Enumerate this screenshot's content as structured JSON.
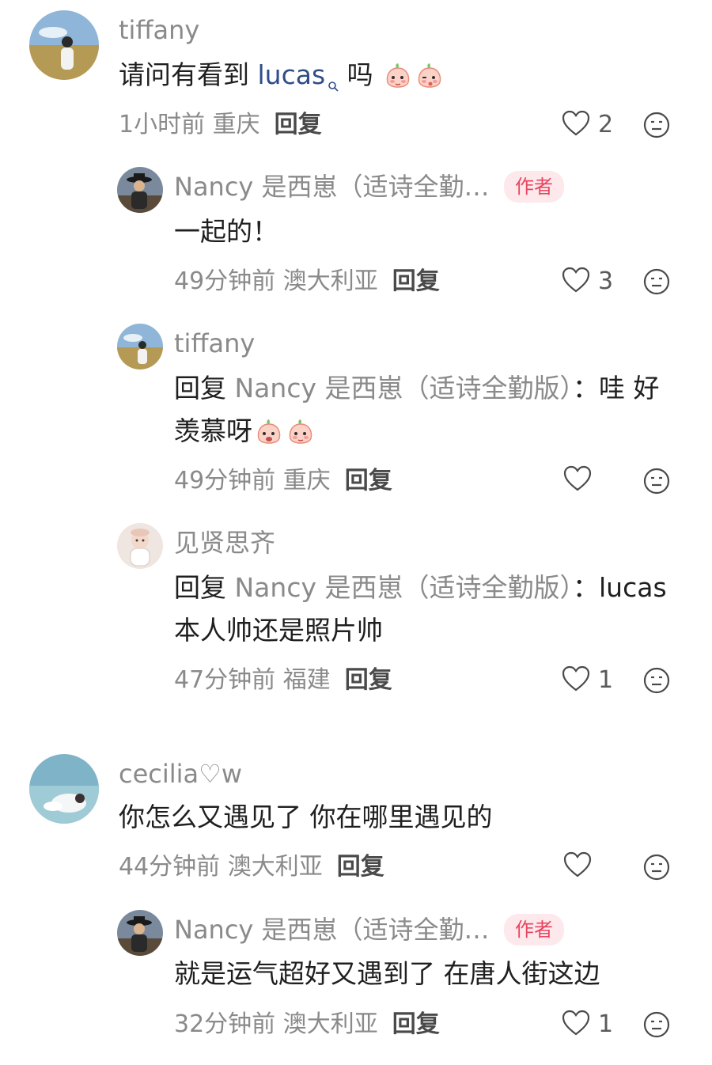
{
  "comments": [
    {
      "user": "tiffany",
      "text_before": "请问有看到 ",
      "mention": "lucas",
      "text_after": " 吗",
      "emojis": [
        "peach-shy-emoji",
        "peach-wink-emoji"
      ],
      "time": "1小时前",
      "location": "重庆",
      "reply_label": "回复",
      "likes": "2"
    },
    {
      "user": "Nancy 是西崽（适诗全勤…",
      "badge": "作者",
      "text": "一起的！",
      "time": "49分钟前",
      "location": "澳大利亚",
      "reply_label": "回复",
      "likes": "3"
    },
    {
      "user": "tiffany",
      "reply_prefix": "回复",
      "reply_target": "Nancy 是西崽（适诗全勤版）",
      "text_line1": "：哇 好",
      "text_line2": "羡慕呀",
      "emojis": [
        "peach-shocked-emoji",
        "peach-shy-emoji"
      ],
      "time": "49分钟前",
      "location": "重庆",
      "reply_label": "回复",
      "likes": ""
    },
    {
      "user": "见贤思齐",
      "reply_prefix": "回复",
      "reply_target": "Nancy 是西崽（适诗全勤版）",
      "text_line1": "：lucas",
      "text_line2": "本人帅还是照片帅",
      "time": "47分钟前",
      "location": "福建",
      "reply_label": "回复",
      "likes": "1"
    },
    {
      "user": "cecilia♡w",
      "text": "你怎么又遇见了 你在哪里遇见的",
      "time": "44分钟前",
      "location": "澳大利亚",
      "reply_label": "回复",
      "likes": ""
    },
    {
      "user": "Nancy 是西崽（适诗全勤…",
      "badge": "作者",
      "text": "就是运气超好又遇到了 在唐人街这边",
      "time": "32分钟前",
      "location": "澳大利亚",
      "reply_label": "回复",
      "likes": "1"
    }
  ],
  "colors": {
    "author_badge_text": "#e8455f",
    "author_badge_bg": "#fde9ec",
    "mention": "#2f4d8a",
    "meta": "#8a8a8a"
  }
}
